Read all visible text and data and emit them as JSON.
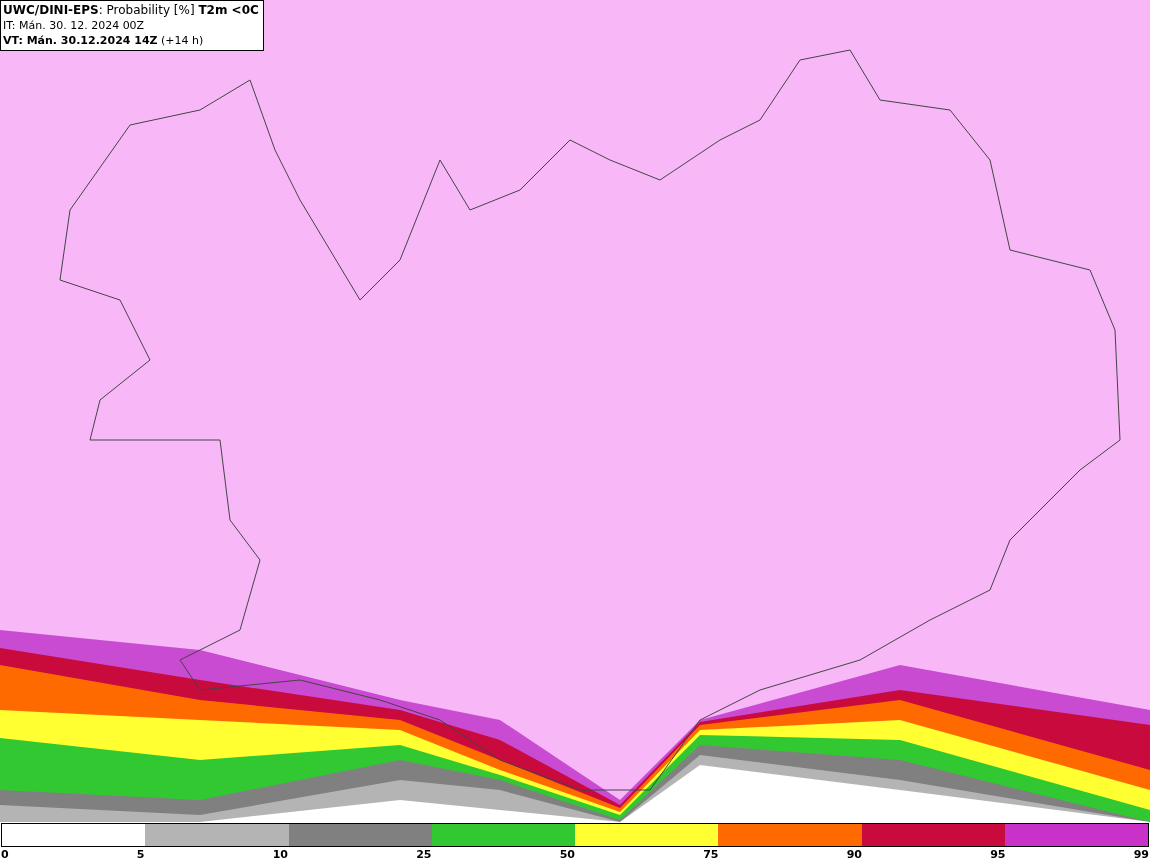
{
  "info_box": {
    "title": "**UWC/DINI-EPS**: Probability [%] **T2m <0C**",
    "initial_time": "IT: Mán. 30. 12. 2024 00Z",
    "valid_time": "**VT: Mán. 30.12.2024 14Z** (+14 h)"
  },
  "legend": {
    "segments": [
      {
        "color": "#ffffff"
      },
      {
        "color": "#b4b4b4"
      },
      {
        "color": "#808080"
      },
      {
        "color": "#32c832"
      },
      {
        "color": "#ffff32"
      },
      {
        "color": "#ff6a00"
      },
      {
        "color": "#c80a3c"
      },
      {
        "color": "#c832c8"
      }
    ],
    "labels": [
      "0",
      "5",
      "10",
      "25",
      "50",
      "75",
      "90",
      "95",
      "99"
    ]
  }
}
